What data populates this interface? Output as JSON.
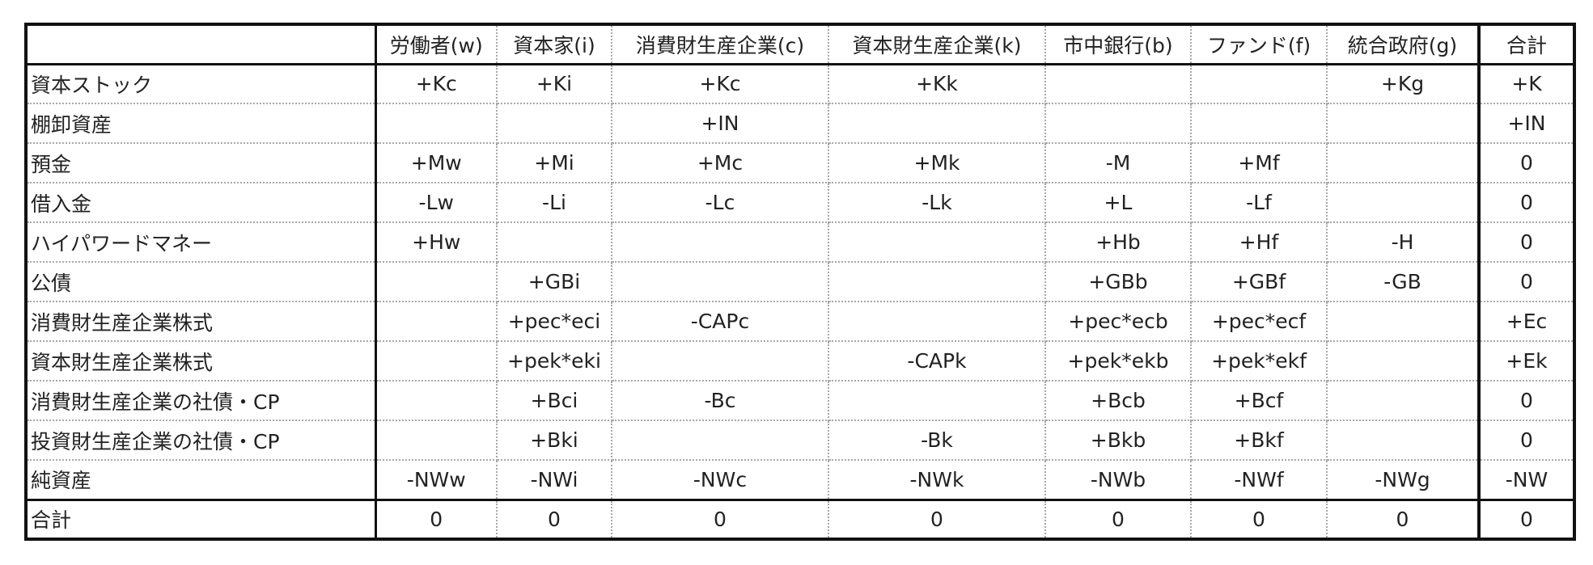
{
  "table": {
    "corner": "",
    "columns": [
      "労働者(w)",
      "資本家(i)",
      "消費財生産企業(c)",
      "資本財生産企業(k)",
      "市中銀行(b)",
      "ファンド(f)",
      "統合政府(g)"
    ],
    "total_header": "合計",
    "rows": [
      {
        "label": "資本ストック",
        "cells": [
          "+Kc",
          "+Ki",
          "+Kc",
          "+Kk",
          "",
          "",
          "+Kg"
        ],
        "total": "+K"
      },
      {
        "label": "棚卸資産",
        "cells": [
          "",
          "",
          "+IN",
          "",
          "",
          "",
          ""
        ],
        "total": "+IN"
      },
      {
        "label": "預金",
        "cells": [
          "+Mw",
          "+Mi",
          "+Mc",
          "+Mk",
          "-M",
          "+Mf",
          ""
        ],
        "total": "0"
      },
      {
        "label": "借入金",
        "cells": [
          "-Lw",
          "-Li",
          "-Lc",
          "-Lk",
          "+L",
          "-Lf",
          ""
        ],
        "total": "0"
      },
      {
        "label": "ハイパワードマネー",
        "cells": [
          "+Hw",
          "",
          "",
          "",
          "+Hb",
          "+Hf",
          "-H"
        ],
        "total": "0"
      },
      {
        "label": "公債",
        "cells": [
          "",
          "+GBi",
          "",
          "",
          "+GBb",
          "+GBf",
          "-GB"
        ],
        "total": "0"
      },
      {
        "label": "消費財生産企業株式",
        "cells": [
          "",
          "+pec*eci",
          "-CAPc",
          "",
          "+pec*ecb",
          "+pec*ecf",
          ""
        ],
        "total": "+Ec"
      },
      {
        "label": "資本財生産企業株式",
        "cells": [
          "",
          "+pek*eki",
          "",
          "-CAPk",
          "+pek*ekb",
          "+pek*ekf",
          ""
        ],
        "total": "+Ek"
      },
      {
        "label": "消費財生産企業の社債・CP",
        "cells": [
          "",
          "+Bci",
          "-Bc",
          "",
          "+Bcb",
          "+Bcf",
          ""
        ],
        "total": "0"
      },
      {
        "label": "投資財生産企業の社債・CP",
        "cells": [
          "",
          "+Bki",
          "",
          "-Bk",
          "+Bkb",
          "+Bkf",
          ""
        ],
        "total": "0"
      },
      {
        "label": "純資産",
        "cells": [
          "-NWw",
          "-NWi",
          "-NWc",
          "-NWk",
          "-NWb",
          "-NWf",
          "-NWg"
        ],
        "total": "-NW"
      }
    ],
    "sum_row": {
      "label": "合計",
      "cells": [
        "0",
        "0",
        "0",
        "0",
        "0",
        "0",
        "0"
      ],
      "total": "0"
    }
  }
}
